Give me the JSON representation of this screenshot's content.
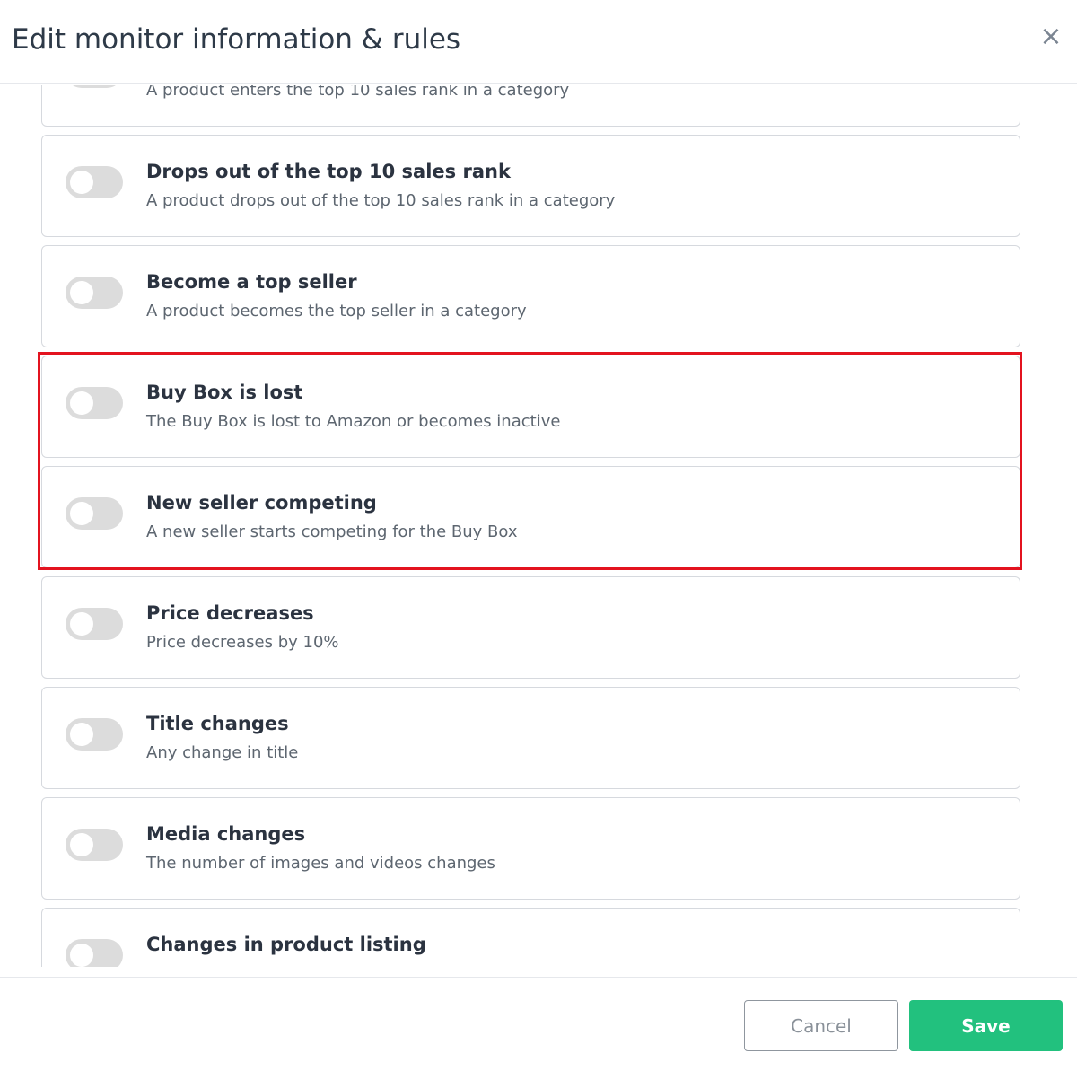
{
  "modal": {
    "title": "Edit monitor information & rules",
    "close_symbol": "×"
  },
  "rules": [
    {
      "title": "",
      "description": "A product enters the top 10 sales rank in a category",
      "enabled": false
    },
    {
      "title": "Drops out of the top 10 sales rank",
      "description": "A product drops out of the top 10 sales rank in a category",
      "enabled": false
    },
    {
      "title": "Become a top seller",
      "description": "A product becomes the top seller in a category",
      "enabled": false
    },
    {
      "title": "Buy Box is lost",
      "description": "The Buy Box is lost to Amazon or becomes inactive",
      "enabled": false
    },
    {
      "title": "New seller competing",
      "description": "A new seller starts competing for the Buy Box",
      "enabled": false
    },
    {
      "title": "Price decreases",
      "description": "Price decreases by 10%",
      "enabled": false
    },
    {
      "title": "Title changes",
      "description": "Any change in title",
      "enabled": false
    },
    {
      "title": "Media changes",
      "description": "The number of images and videos changes",
      "enabled": false
    },
    {
      "title": "Changes in product listing",
      "description": "",
      "enabled": false
    }
  ],
  "footer": {
    "cancel_label": "Cancel",
    "save_label": "Save"
  },
  "colors": {
    "save_button": "#22c17e",
    "highlight_border": "#e3131f",
    "toggle_off": "#dcdcdc"
  }
}
